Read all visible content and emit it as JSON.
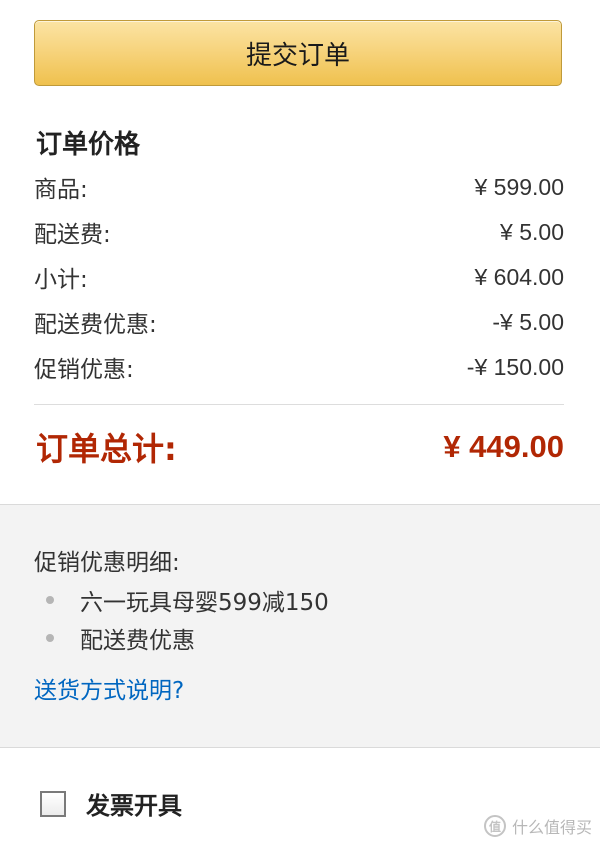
{
  "submit_button": {
    "label": "提交订单"
  },
  "summary": {
    "title": "订单价格",
    "rows": [
      {
        "label": "商品:",
        "amount": "¥ 599.00"
      },
      {
        "label": "配送费:",
        "amount": "¥ 5.00"
      },
      {
        "label": "小计:",
        "amount": "¥ 604.00"
      },
      {
        "label": "配送费优惠:",
        "amount": "-¥ 5.00"
      },
      {
        "label": "促销优惠:",
        "amount": "-¥ 150.00"
      }
    ],
    "total": {
      "label": "订单总计:",
      "amount": "¥ 449.00"
    }
  },
  "promotions": {
    "title": "促销优惠明细:",
    "items": [
      "六一玩具母婴599减150",
      "配送费优惠"
    ],
    "shipping_link": "送货方式说明?"
  },
  "invoice": {
    "label": "发票开具",
    "checked": false
  },
  "watermark": {
    "icon_text": "值",
    "text": "什么值得买"
  },
  "colors": {
    "button_gradient_top": "#fbe4a4",
    "button_gradient_bottom": "#efc14e",
    "total_red": "#b12704",
    "link_blue": "#0066c0",
    "panel_gray": "#f3f3f3"
  }
}
